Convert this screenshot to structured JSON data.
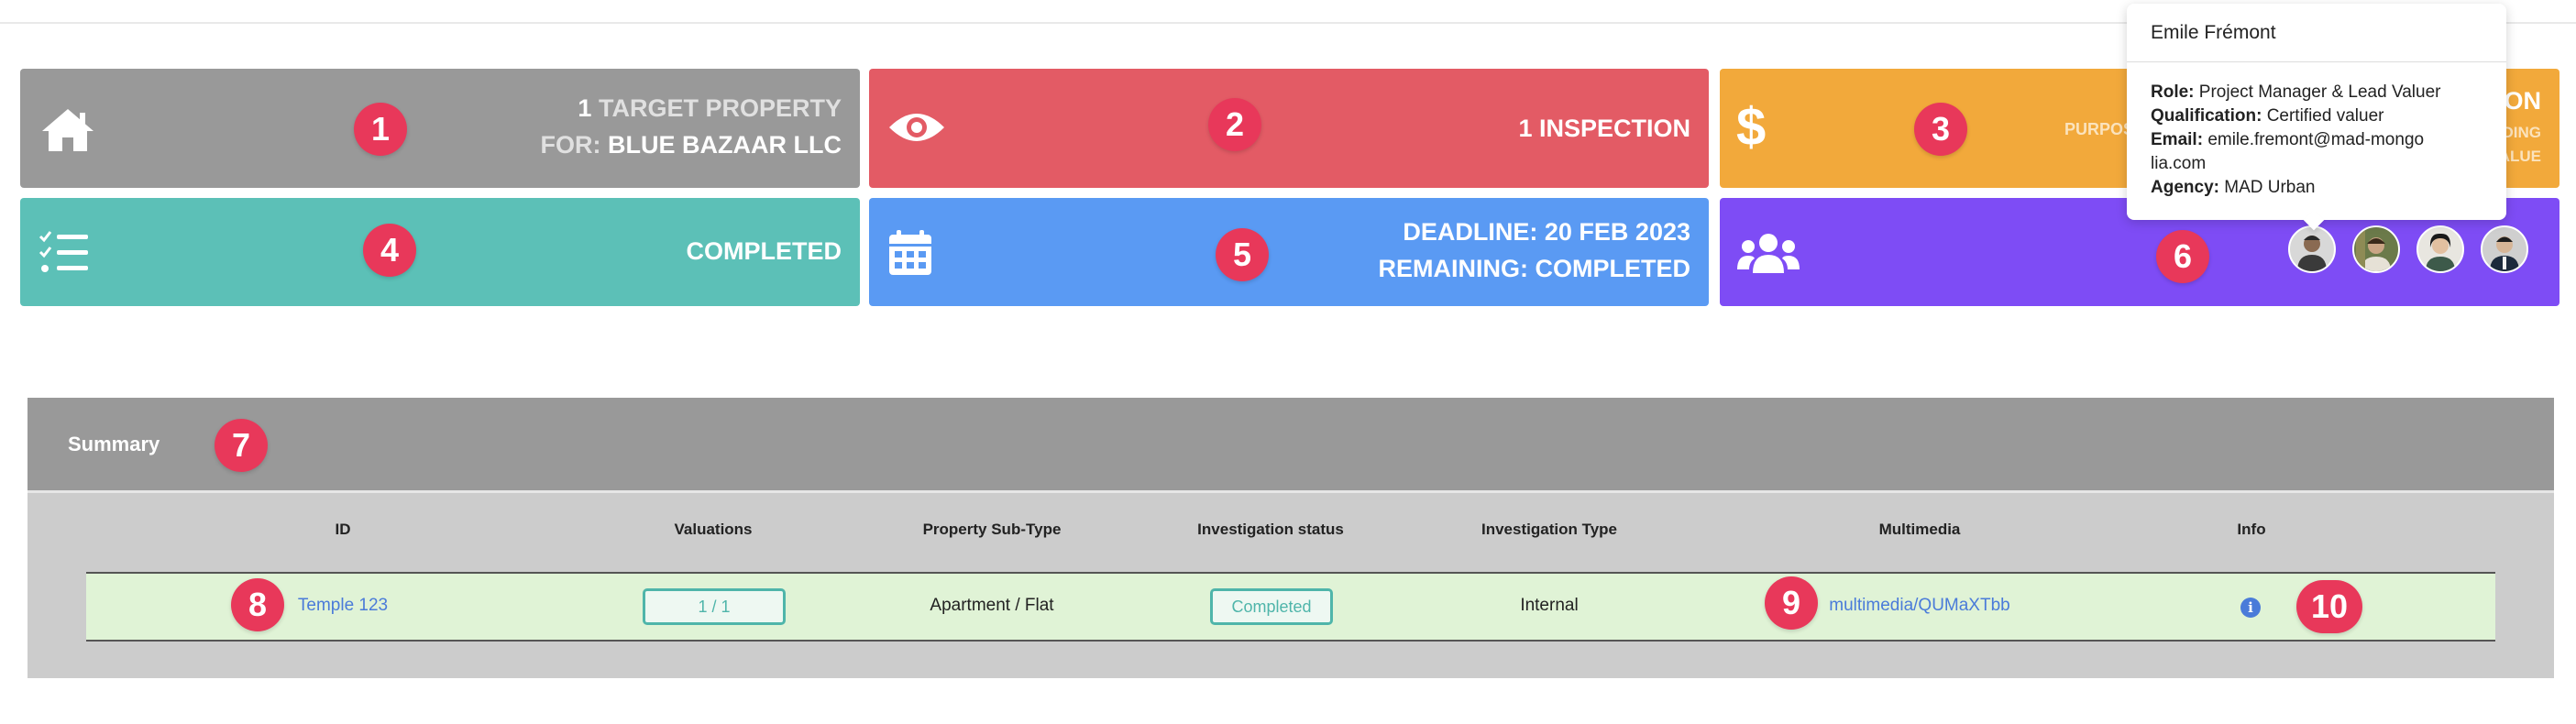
{
  "cards": {
    "target": {
      "count": "1",
      "label": "TARGET PROPERTY",
      "for_label": "FOR:",
      "client": "BLUE BAZAAR LLC",
      "icon": "home-icon"
    },
    "inspection": {
      "text": "1 INSPECTION",
      "icon": "eye-icon"
    },
    "purpose": {
      "title": "ON",
      "left_label": "PURPOS",
      "line2": "DING",
      "line3": "ALUE",
      "icon": "dollar-icon"
    },
    "status": {
      "text": "COMPLETED",
      "icon": "checklist-icon"
    },
    "deadline": {
      "line1": "DEADLINE: 20 FEB 2023",
      "line2": "REMAINING: COMPLETED",
      "icon": "calendar-icon"
    },
    "team": {
      "icon": "users-icon"
    }
  },
  "badges": [
    "1",
    "2",
    "3",
    "4",
    "5",
    "6",
    "7",
    "8",
    "9",
    "10"
  ],
  "tooltip": {
    "name": "Emile Frémont",
    "role_label": "Role:",
    "role": "Project Manager & Lead Valuer",
    "qual_label": "Qualification:",
    "qual": "Certified valuer",
    "email_label": "Email:",
    "email": "emile.fremont@mad-mongolia.com",
    "agency_label": "Agency:",
    "agency": "MAD Urban"
  },
  "summary": {
    "title": "Summary",
    "columns": [
      "ID",
      "Valuations",
      "Property Sub-Type",
      "Investigation status",
      "Investigation Type",
      "Multimedia",
      "Info"
    ],
    "row": {
      "id": "Temple 123",
      "valuations": "1 / 1",
      "sub_type": "Apartment / Flat",
      "status": "Completed",
      "type": "Internal",
      "multimedia": "multimedia/QUMaXTbb",
      "info": "i"
    }
  },
  "colors": {
    "grey": "#999999",
    "red": "#e35b65",
    "orange": "#f2a93b",
    "teal": "#5cc0b7",
    "blue": "#5a9af3",
    "purple": "#7e4cf5",
    "badge": "#e8385a",
    "row_bg": "#e0f3d6"
  }
}
